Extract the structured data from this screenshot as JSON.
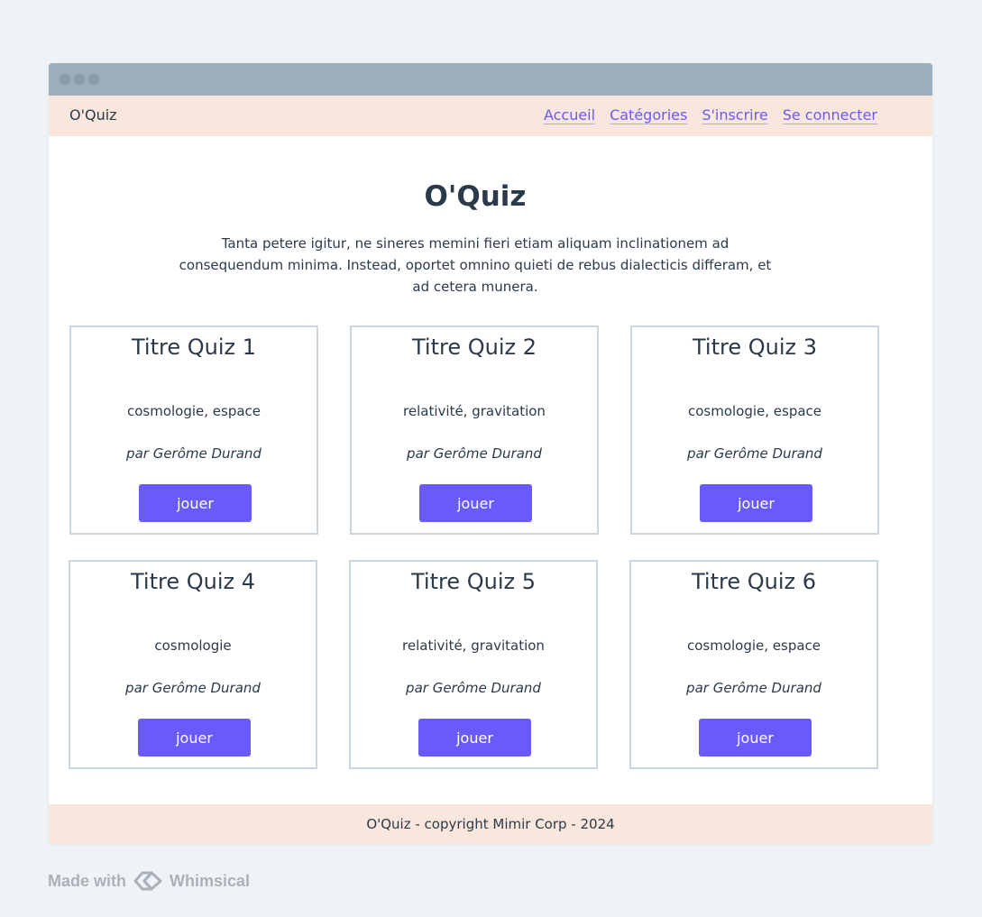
{
  "navbar": {
    "brand": "O'Quiz",
    "links": [
      {
        "label": "Accueil"
      },
      {
        "label": "Catégories"
      },
      {
        "label": "S'inscrire"
      },
      {
        "label": "Se connecter"
      }
    ]
  },
  "hero": {
    "title": "O'Quiz",
    "text": "Tanta petere igitur, ne sineres memini fieri etiam aliquam inclinationem ad consequendum minima. Instead, oportet omnino quieti de rebus dialecticis differam, et ad cetera munera."
  },
  "quizzes": [
    {
      "title": "Titre Quiz 1",
      "tags": "cosmologie, espace",
      "author": "par Gerôme Durand",
      "button": "jouer"
    },
    {
      "title": "Titre Quiz 2",
      "tags": "relativité, gravitation",
      "author": "par Gerôme Durand",
      "button": "jouer"
    },
    {
      "title": "Titre Quiz 3",
      "tags": "cosmologie, espace",
      "author": "par Gerôme Durand",
      "button": "jouer"
    },
    {
      "title": "Titre Quiz 4",
      "tags": "cosmologie",
      "author": "par Gerôme Durand",
      "button": "jouer"
    },
    {
      "title": "Titre Quiz 5",
      "tags": "relativité, gravitation",
      "author": "par Gerôme Durand",
      "button": "jouer"
    },
    {
      "title": "Titre Quiz 6",
      "tags": "cosmologie, espace",
      "author": "par Gerôme Durand",
      "button": "jouer"
    }
  ],
  "footer": {
    "text": "O'Quiz - copyright Mimir Corp - 2024"
  },
  "watermark": {
    "made_with": "Made with",
    "brand": "Whimsical"
  },
  "colors": {
    "accent": "#6a5af9",
    "nav_background": "#f9e6dc",
    "titlebar": "#9dafbc",
    "page_background": "#f0f3f6",
    "card_border": "#cbd6df",
    "text": "#2b3a4a"
  }
}
